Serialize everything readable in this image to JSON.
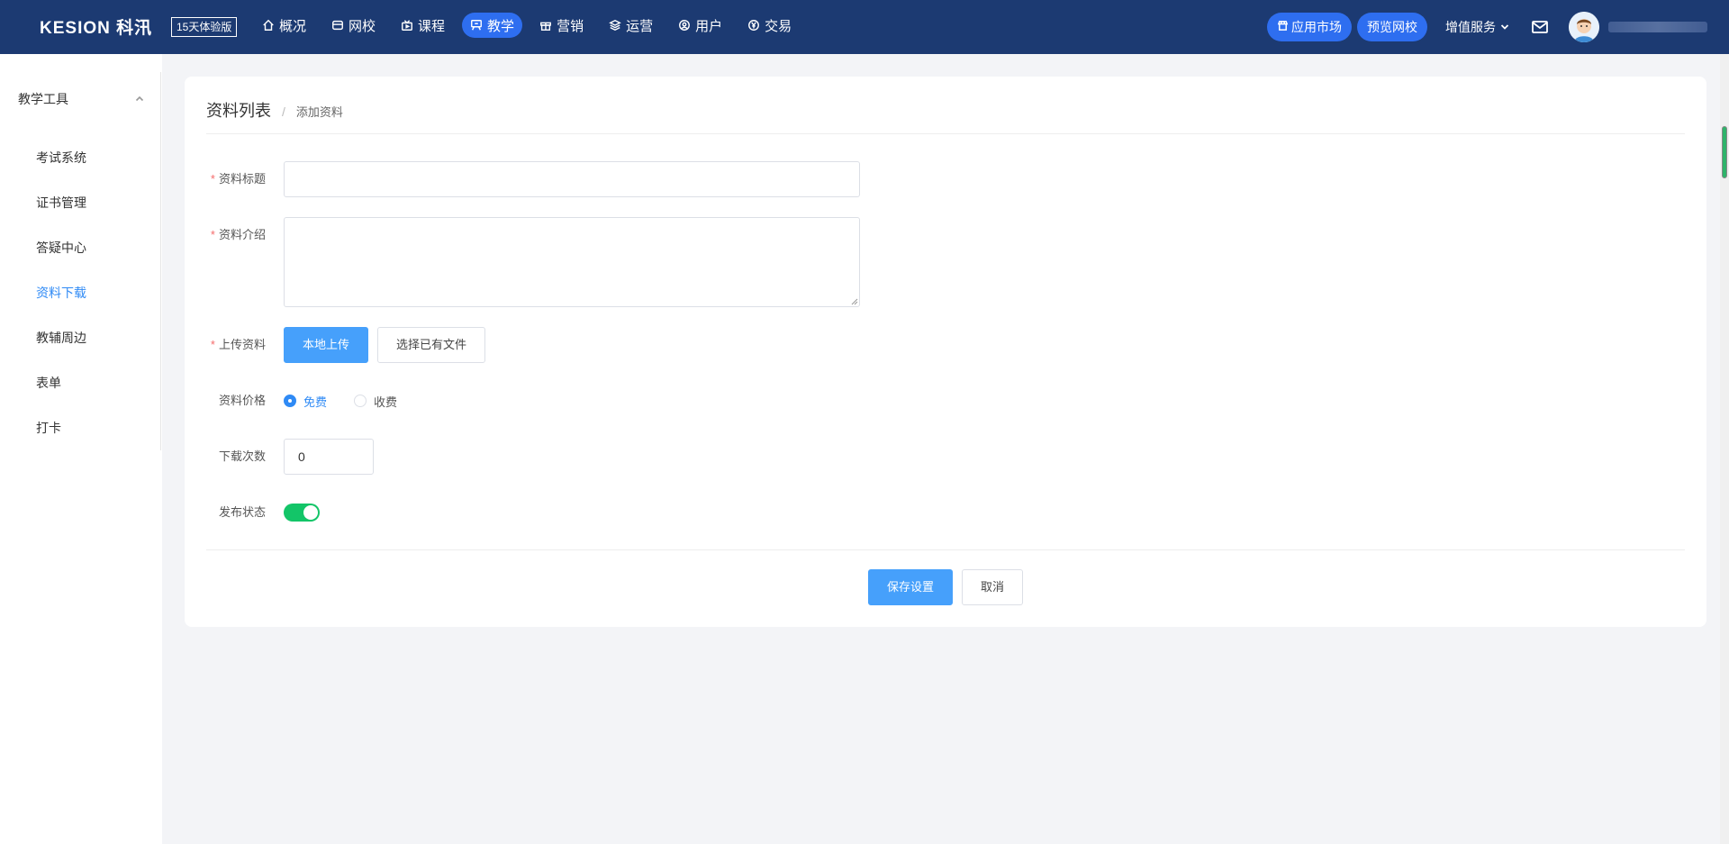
{
  "brand": {
    "logo": "KESION 科汛",
    "trial_badge": "15天体验版"
  },
  "nav": [
    {
      "label": "概况",
      "icon": "home-icon",
      "active": false
    },
    {
      "label": "网校",
      "icon": "school-icon",
      "active": false
    },
    {
      "label": "课程",
      "icon": "video-icon",
      "active": false
    },
    {
      "label": "教学",
      "icon": "teaching-icon",
      "active": true
    },
    {
      "label": "营销",
      "icon": "gift-icon",
      "active": false
    },
    {
      "label": "运营",
      "icon": "layers-icon",
      "active": false
    },
    {
      "label": "用户",
      "icon": "user-icon",
      "active": false
    },
    {
      "label": "交易",
      "icon": "yen-icon",
      "active": false
    }
  ],
  "header_tools": {
    "app_market": "应用市场",
    "preview_school": "预览网校",
    "value_added": "增值服务"
  },
  "sidebar": {
    "group_title": "教学工具",
    "items": [
      {
        "label": "考试系统",
        "active": false
      },
      {
        "label": "证书管理",
        "active": false
      },
      {
        "label": "答疑中心",
        "active": false
      },
      {
        "label": "资料下载",
        "active": true
      },
      {
        "label": "教辅周边",
        "active": false
      },
      {
        "label": "表单",
        "active": false
      },
      {
        "label": "打卡",
        "active": false
      }
    ]
  },
  "breadcrumb": {
    "main": "资料列表",
    "sub": "添加资料"
  },
  "form": {
    "title_label": "资料标题",
    "title_value": "",
    "intro_label": "资料介绍",
    "intro_value": "",
    "upload_label": "上传资料",
    "upload_local": "本地上传",
    "upload_existing": "选择已有文件",
    "price_label": "资料价格",
    "price_options": [
      "免费",
      "收费"
    ],
    "price_selected": "免费",
    "downloads_label": "下载次数",
    "downloads_value": "0",
    "publish_label": "发布状态",
    "publish_on": true
  },
  "actions": {
    "save": "保存设置",
    "cancel": "取消"
  },
  "colors": {
    "topbar": "#1c3a72",
    "accent": "#2e6ef0",
    "primary_button": "#46a0fb",
    "active_link": "#2f8af5",
    "switch_on": "#13c568"
  }
}
